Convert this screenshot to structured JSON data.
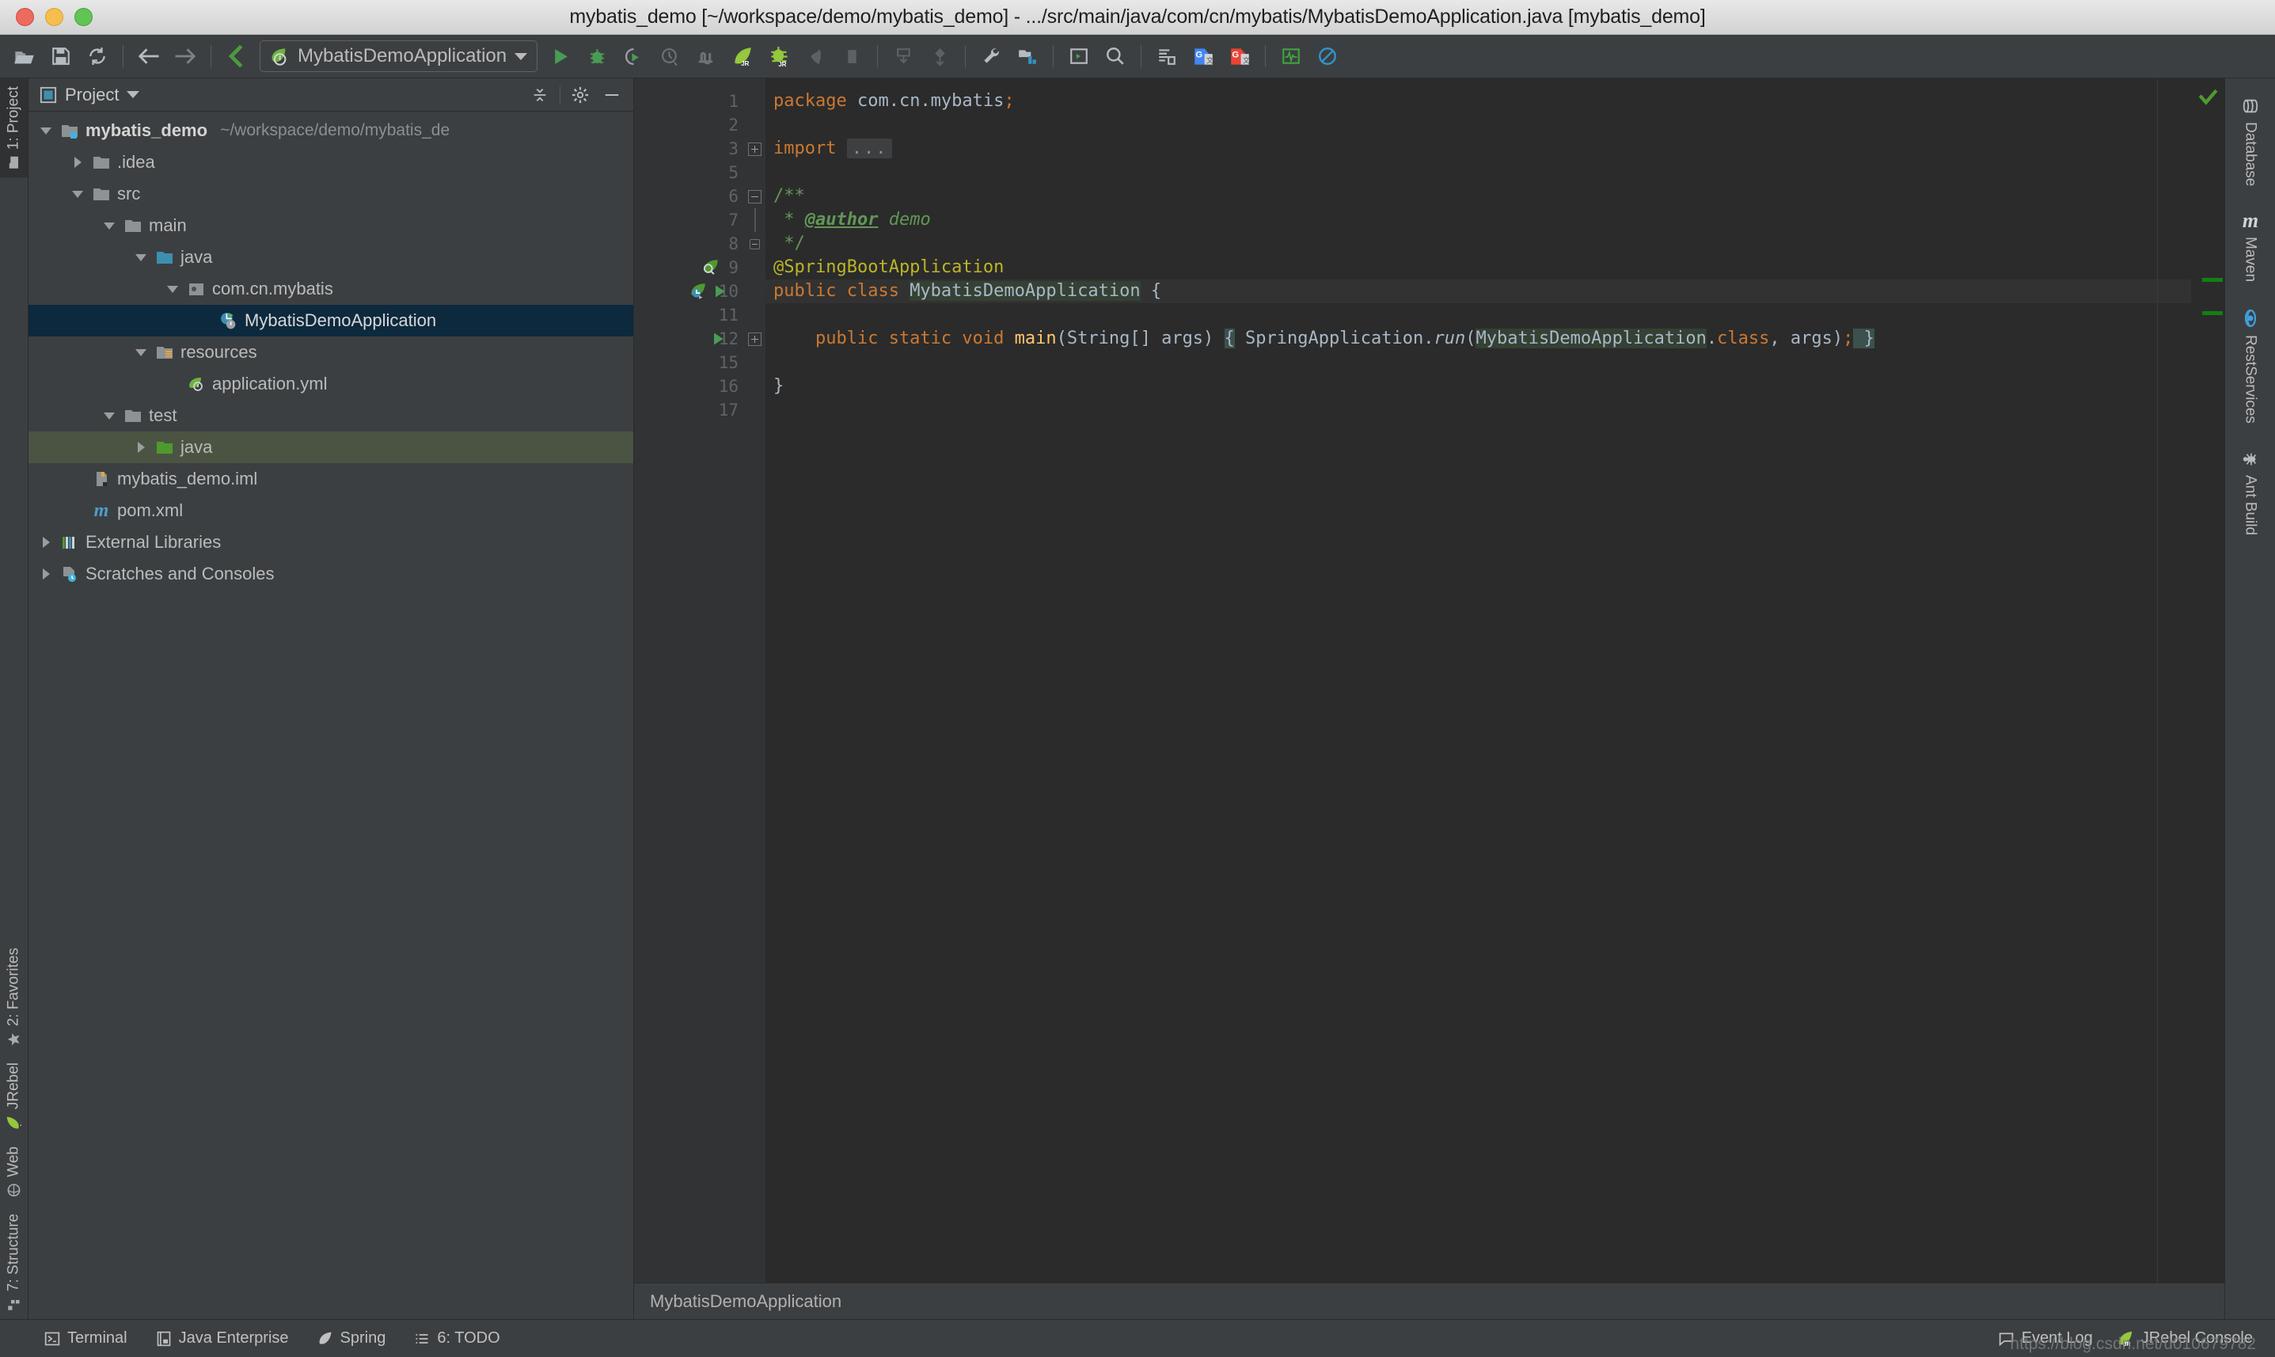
{
  "window": {
    "title": "mybatis_demo [~/workspace/demo/mybatis_demo] - .../src/main/java/com/cn/mybatis/MybatisDemoApplication.java [mybatis_demo]",
    "traffic_lights": [
      "close-red",
      "minimize-yellow",
      "zoom-green"
    ]
  },
  "toolbar": {
    "icons": [
      "open-folder-icon",
      "save-all-icon",
      "sync-refresh-icon",
      "back-arrow-icon",
      "forward-arrow-icon",
      "jump-to-source-icon"
    ],
    "run_config": {
      "label": "MybatisDemoApplication",
      "icon": "spring-boot-icon",
      "dropdown": "chevron-down-icon"
    },
    "right_icons": [
      "run-icon",
      "debug-icon",
      "run-coverage-icon",
      "profile-icon",
      "attach-process-icon",
      "jrebel-run-icon",
      "jrebel-debug-icon",
      "stop-gray-icon",
      "stop-square-icon",
      "update-app-icon",
      "import-changes-icon",
      "settings-wrench-icon",
      "project-structure-icon",
      "console-icon",
      "search-everywhere-icon",
      "database-console-icon",
      "google-translate-blue-icon",
      "google-translate-red-icon",
      "monitor-icon",
      "no-entry-icon"
    ]
  },
  "left_rail": {
    "top": [
      {
        "label": "1: Project",
        "num": "1",
        "rest": ": Project",
        "icon": "project-folder-icon",
        "active": true
      }
    ],
    "bottom": [
      {
        "label": "2: Favorites",
        "num": "2",
        "rest": ": Favorites",
        "icon": "star-icon",
        "active": false
      },
      {
        "label": "JRebel",
        "num": "",
        "rest": "JRebel",
        "icon": "jrebel-icon",
        "active": false
      },
      {
        "label": "Web",
        "num": "",
        "rest": "Web",
        "icon": "web-globe-icon",
        "active": false
      },
      {
        "label": "7: Structure",
        "num": "7",
        "rest": ": Structure",
        "icon": "structure-icon",
        "active": false
      }
    ]
  },
  "right_rail": {
    "items": [
      {
        "label": "Database",
        "icon": "database-icon"
      },
      {
        "label": "Maven",
        "icon": "maven-m-icon"
      },
      {
        "label": "RestServices",
        "icon": "rest-services-icon"
      },
      {
        "label": "Ant Build",
        "icon": "ant-build-icon"
      }
    ]
  },
  "project_panel": {
    "title": "Project",
    "title_dropdown": "chevron-down-icon",
    "header_icons": [
      "collapse-all-icon",
      "settings-gear-icon",
      "hide-panel-icon"
    ],
    "tree": [
      {
        "label": "mybatis_demo",
        "path": "~/workspace/demo/mybatis_de",
        "indent": 0,
        "arrow": "open",
        "icon": "module-root-icon",
        "bold": true,
        "state": "none"
      },
      {
        "label": ".idea",
        "path": "",
        "indent": 1,
        "arrow": "closed",
        "icon": "folder-gray-icon",
        "bold": false,
        "state": "none"
      },
      {
        "label": "src",
        "path": "",
        "indent": 1,
        "arrow": "open",
        "icon": "folder-gray-icon",
        "bold": false,
        "state": "none"
      },
      {
        "label": "main",
        "path": "",
        "indent": 2,
        "arrow": "open",
        "icon": "folder-gray-icon",
        "bold": false,
        "state": "none"
      },
      {
        "label": "java",
        "path": "",
        "indent": 3,
        "arrow": "open",
        "icon": "source-root-blue-icon",
        "bold": false,
        "state": "none"
      },
      {
        "label": "com.cn.mybatis",
        "path": "",
        "indent": 4,
        "arrow": "open",
        "icon": "package-icon",
        "bold": false,
        "state": "none"
      },
      {
        "label": "MybatisDemoApplication",
        "path": "",
        "indent": 5,
        "arrow": "none",
        "icon": "spring-class-icon",
        "bold": false,
        "state": "selected"
      },
      {
        "label": "resources",
        "path": "",
        "indent": 3,
        "arrow": "open",
        "icon": "resource-root-icon",
        "bold": false,
        "state": "none"
      },
      {
        "label": "application.yml",
        "path": "",
        "indent": 4,
        "arrow": "none",
        "icon": "spring-yaml-icon",
        "bold": false,
        "state": "none"
      },
      {
        "label": "test",
        "path": "",
        "indent": 2,
        "arrow": "open",
        "icon": "folder-gray-icon",
        "bold": false,
        "state": "none"
      },
      {
        "label": "java",
        "path": "",
        "indent": 3,
        "arrow": "closed",
        "icon": "test-source-root-green-icon",
        "bold": false,
        "state": "dim-selected"
      },
      {
        "label": "mybatis_demo.iml",
        "path": "",
        "indent": 1,
        "arrow": "none",
        "icon": "iml-file-icon",
        "bold": false,
        "state": "none"
      },
      {
        "label": "pom.xml",
        "path": "",
        "indent": 1,
        "arrow": "none",
        "icon": "maven-pom-icon",
        "bold": false,
        "state": "none"
      },
      {
        "label": "External Libraries",
        "path": "",
        "indent": 0,
        "arrow": "closed",
        "icon": "libraries-icon",
        "bold": false,
        "state": "none"
      },
      {
        "label": "Scratches and Consoles",
        "path": "",
        "indent": 0,
        "arrow": "closed",
        "icon": "scratches-icon",
        "bold": false,
        "state": "none"
      }
    ]
  },
  "editor": {
    "line_numbers": [
      "1",
      "2",
      "3",
      "5",
      "6",
      "7",
      "8",
      "9",
      "10",
      "11",
      "12",
      "15",
      "16",
      "17"
    ],
    "current_line_index": 8,
    "gutter_icons": [
      {
        "line_index": 8,
        "icon": "spring-bean-search-icon"
      },
      {
        "line_index": 9,
        "icon": "spring-bean-icon"
      },
      {
        "line_index": 9,
        "icon": "run-gutter-icon"
      },
      {
        "line_index": 11,
        "icon": "run-gutter-icon"
      }
    ],
    "code": [
      {
        "segments": [
          {
            "t": "package ",
            "c": "tok-kw"
          },
          {
            "t": "com.cn.mybatis",
            "c": "tok-txt"
          },
          {
            "t": ";",
            "c": "tok-kw"
          }
        ]
      },
      {
        "segments": []
      },
      {
        "segments": [
          {
            "t": "import ",
            "c": "tok-kw"
          },
          {
            "t": "...",
            "c": "fold-dots"
          }
        ],
        "fold": "plus"
      },
      {
        "segments": []
      },
      {
        "segments": [
          {
            "t": "/**",
            "c": "tok-cmt"
          }
        ],
        "fold": "minus-top"
      },
      {
        "segments": [
          {
            "t": " * ",
            "c": "tok-cmt"
          },
          {
            "t": "@author",
            "c": "tok-tag"
          },
          {
            "t": " demo",
            "c": "tok-cmt-i"
          }
        ]
      },
      {
        "segments": [
          {
            "t": " */",
            "c": "tok-cmt"
          }
        ],
        "fold": "cap"
      },
      {
        "segments": [
          {
            "t": "@SpringBootApplication",
            "c": "tok-ann"
          }
        ]
      },
      {
        "segments": [
          {
            "t": "public class ",
            "c": "tok-kw"
          },
          {
            "t": "MybatisDemoApplication",
            "c": "tok-txt hl-ident"
          },
          {
            "t": " {",
            "c": "tok-txt"
          }
        ]
      },
      {
        "segments": []
      },
      {
        "segments": [
          {
            "t": "    public static void ",
            "c": "tok-kw"
          },
          {
            "t": "main",
            "c": "tok-fn"
          },
          {
            "t": "(String[] args) ",
            "c": "tok-txt"
          },
          {
            "t": "{",
            "c": "tok-txt hl-brace"
          },
          {
            "t": " SpringApplication.",
            "c": "tok-txt"
          },
          {
            "t": "run",
            "c": "tok-static"
          },
          {
            "t": "(",
            "c": "tok-txt"
          },
          {
            "t": "MybatisDemoApplication",
            "c": "tok-txt hl-ident"
          },
          {
            "t": ".",
            "c": "tok-txt"
          },
          {
            "t": "class",
            "c": "tok-kw"
          },
          {
            "t": ", args)",
            "c": "tok-txt"
          },
          {
            "t": ";",
            "c": "tok-kw"
          },
          {
            "t": " }",
            "c": "tok-txt hl-brace"
          }
        ],
        "fold": "plus"
      },
      {
        "segments": []
      },
      {
        "segments": [
          {
            "t": "}",
            "c": "tok-txt"
          }
        ]
      },
      {
        "segments": []
      }
    ],
    "stripe": {
      "status_icon": "inspection-ok-check-icon",
      "markers": [
        "change-marker-green",
        "change-marker-green"
      ]
    },
    "breadcrumb": "MybatisDemoApplication"
  },
  "status_bar": {
    "left_items": [
      {
        "label": "Terminal",
        "icon": "terminal-icon"
      },
      {
        "label": "Java Enterprise",
        "icon": "java-enterprise-icon"
      },
      {
        "label": "Spring",
        "icon": "spring-leaf-icon"
      },
      {
        "label": "6: TODO",
        "num": "6",
        "rest": ": TODO",
        "icon": "todo-list-icon"
      }
    ],
    "right_items": [
      {
        "label": "Event Log",
        "icon": "event-log-icon"
      },
      {
        "label": "JRebel Console",
        "icon": "jrebel-icon"
      }
    ],
    "watermark": "https://blog.csdn.net/u010679782"
  },
  "colors": {
    "accent_green": "#4a9c3f",
    "selection_blue": "#0d293e",
    "dim_selection": "#4b5443",
    "editor_bg": "#2b2b2b",
    "panel_bg": "#3c3f41",
    "gutter_bg": "#313335",
    "keyword_orange": "#cc7832",
    "string_text": "#a9b7c6",
    "comment_green": "#629755",
    "annotation_yellow": "#bbb529",
    "method_yellow": "#ffc66d"
  }
}
